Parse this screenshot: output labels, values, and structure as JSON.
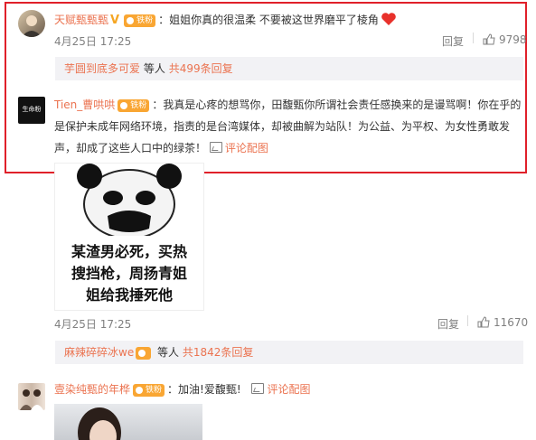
{
  "comments": [
    {
      "user": "天赋甄甄甄",
      "fan_label": "铁粉",
      "text": "：姐姐你真的很温柔 不要被这世界磨平了棱角",
      "date": "4月25日 17:25",
      "reply_label": "回复",
      "likes": "9798",
      "sub_reply": {
        "names": "芋圆到底多可爱",
        "suffix": "等人",
        "total": "共499条回复"
      }
    },
    {
      "user": "Tien_曹哄哄",
      "fan_label": "铁粉",
      "avatar_text": "生命粉",
      "text_lines": [
        "：我真是心疼的想骂你，田馥甄你所谓社会责任感换来的是谩骂啊！你在乎的",
        "是保护未成年网络环境，指责的是台湾媒体，却被曲解为站队！为公益、为平权、为女性勇敢发",
        "声，却成了这些人口中的绿茶！"
      ],
      "pic_link": "评论配图",
      "image_text": [
        "某渣男必死，买热",
        "搜挡枪，周扬青姐",
        "姐给我捶死他"
      ],
      "date": "4月25日 17:25",
      "reply_label": "回复",
      "likes": "11670",
      "sub_reply": {
        "names": "麻辣碎碎冰we",
        "suffix": "等人",
        "total": "共1842条回复"
      }
    },
    {
      "user": "壹染纯甄的年桦",
      "fan_label": "铁粉",
      "text": "：加油!爱馥甄!",
      "pic_link": "评论配图"
    }
  ],
  "colors": {
    "accent": "#eb7350",
    "highlight_border": "#e0202a",
    "heart": "#e8312b"
  }
}
